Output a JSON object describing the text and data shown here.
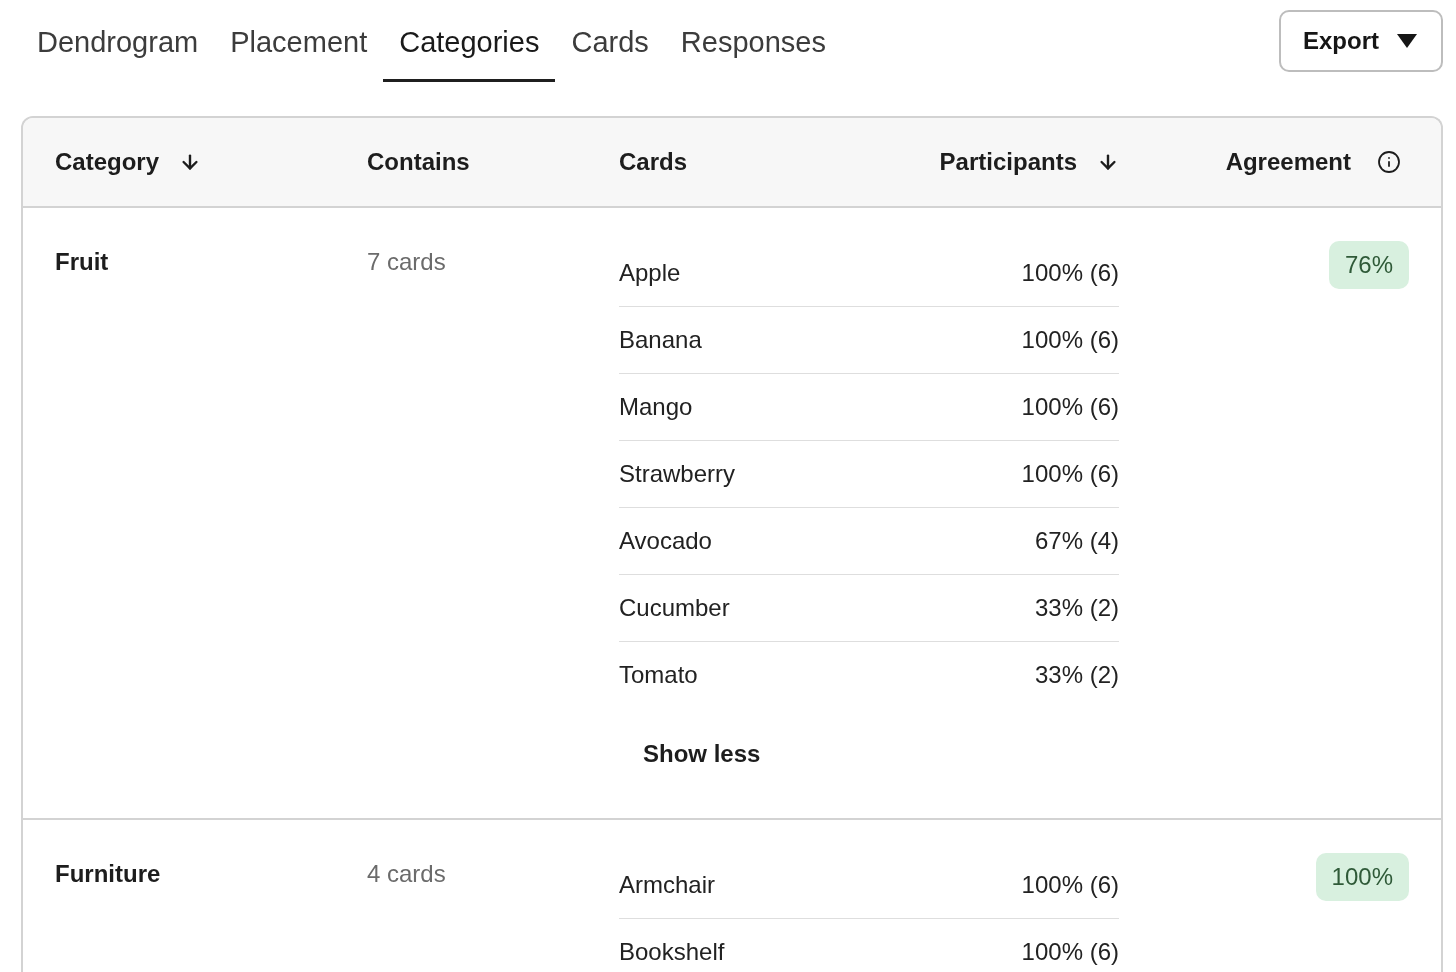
{
  "tabs": [
    {
      "label": "Dendrogram",
      "selected": false
    },
    {
      "label": "Placement",
      "selected": false
    },
    {
      "label": "Categories",
      "selected": true
    },
    {
      "label": "Cards",
      "selected": false
    },
    {
      "label": "Responses",
      "selected": false
    }
  ],
  "export_button": {
    "label": "Export"
  },
  "table": {
    "columns": [
      {
        "label": "Category",
        "kind": "sort"
      },
      {
        "label": "Contains",
        "kind": "plain"
      },
      {
        "label": "Cards",
        "kind": "plain"
      },
      {
        "label": "Participants",
        "kind": "sort"
      },
      {
        "label": "Agreement",
        "kind": "info"
      }
    ],
    "rows": [
      {
        "category": "Fruit",
        "contains": "7 cards",
        "cards": [
          {
            "name": "Apple",
            "participants": "100% (6)"
          },
          {
            "name": "Banana",
            "participants": "100% (6)"
          },
          {
            "name": "Mango",
            "participants": "100% (6)"
          },
          {
            "name": "Strawberry",
            "participants": "100% (6)"
          },
          {
            "name": "Avocado",
            "participants": "67% (4)"
          },
          {
            "name": "Cucumber",
            "participants": "33% (2)"
          },
          {
            "name": "Tomato",
            "participants": "33% (2)"
          }
        ],
        "toggle": "Show less",
        "agreement": "76%"
      },
      {
        "category": "Furniture",
        "contains": "4 cards",
        "cards": [
          {
            "name": "Armchair",
            "participants": "100% (6)"
          },
          {
            "name": "Bookshelf",
            "participants": "100% (6)"
          }
        ],
        "agreement": "100%"
      }
    ]
  }
}
